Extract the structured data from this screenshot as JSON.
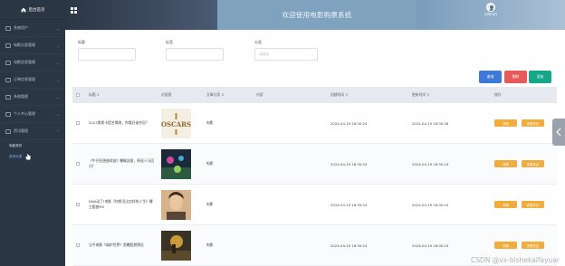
{
  "sidebar": {
    "logo_title": "后台首页",
    "menu": [
      {
        "label": "系统用户"
      },
      {
        "label": "电影分类管理"
      },
      {
        "label": "电影信息管理"
      },
      {
        "label": "订单信息管理"
      },
      {
        "label": "系统管理"
      },
      {
        "label": "个人中心管理"
      },
      {
        "label": "资讯管理"
      }
    ],
    "submenu": [
      {
        "label": "电影资讯"
      },
      {
        "label": "资讯分类"
      }
    ]
  },
  "header": {
    "welcome": "欢迎使用电影购票系统",
    "username": "admin"
  },
  "search": {
    "title_label": "标题",
    "tag_label": "标签",
    "category_label": "分类",
    "category_placeholder": "请选择"
  },
  "toolbar": {
    "search_label": "查询",
    "delete_label": "删除",
    "add_label": "添加"
  },
  "table": {
    "headers": {
      "title": "标题 ⇕",
      "image": "封面图",
      "category": "文章分类 ⇕",
      "content": "内容",
      "created": "创建时间 ⇕",
      "updated": "更新时间 ⇕",
      "ops": "操作"
    },
    "rows": [
      {
        "title": "2023奥斯卡提名揭晓，你看好谁夺冠？",
        "category": "电影",
        "created": "2024-04-19 18:30:24",
        "updated": "2024-04-19 18:30:28",
        "thumb": "oscars-thumb"
      },
      {
        "title": "《牛仔狂想曲续拍》曝概念图，原班人马回归？",
        "category": "电影",
        "created": "2024-04-19 18:30:24",
        "updated": "2024-04-19 18:30:24",
        "thumb": "poster-thumb"
      },
      {
        "title": "DNA动了!电影《你想活出怎样的人生》曝主题曲MV",
        "category": "电影",
        "created": "2024-04-19 18:30:24",
        "updated": "2024-04-19 18:30:24",
        "thumb": "portrait-thumb"
      },
      {
        "title": "当今电影《熔炉世界》首曝超燃预告",
        "category": "电影",
        "created": "2024-04-19 18:30:24",
        "updated": "2024-04-19 18:30:24",
        "thumb": "scene-thumb"
      }
    ],
    "op_edit": "详情",
    "op_comment": "查看评论"
  },
  "watermark": "CSDN @vx-bishekaifayuar",
  "colors": {
    "sidebar_bg": "#2b3645",
    "header_center": "#7fa2be",
    "search_btn": "#3d79d6",
    "delete_btn": "#e8595a",
    "add_btn": "#16a689",
    "op_btn": "#f0ad3d"
  }
}
